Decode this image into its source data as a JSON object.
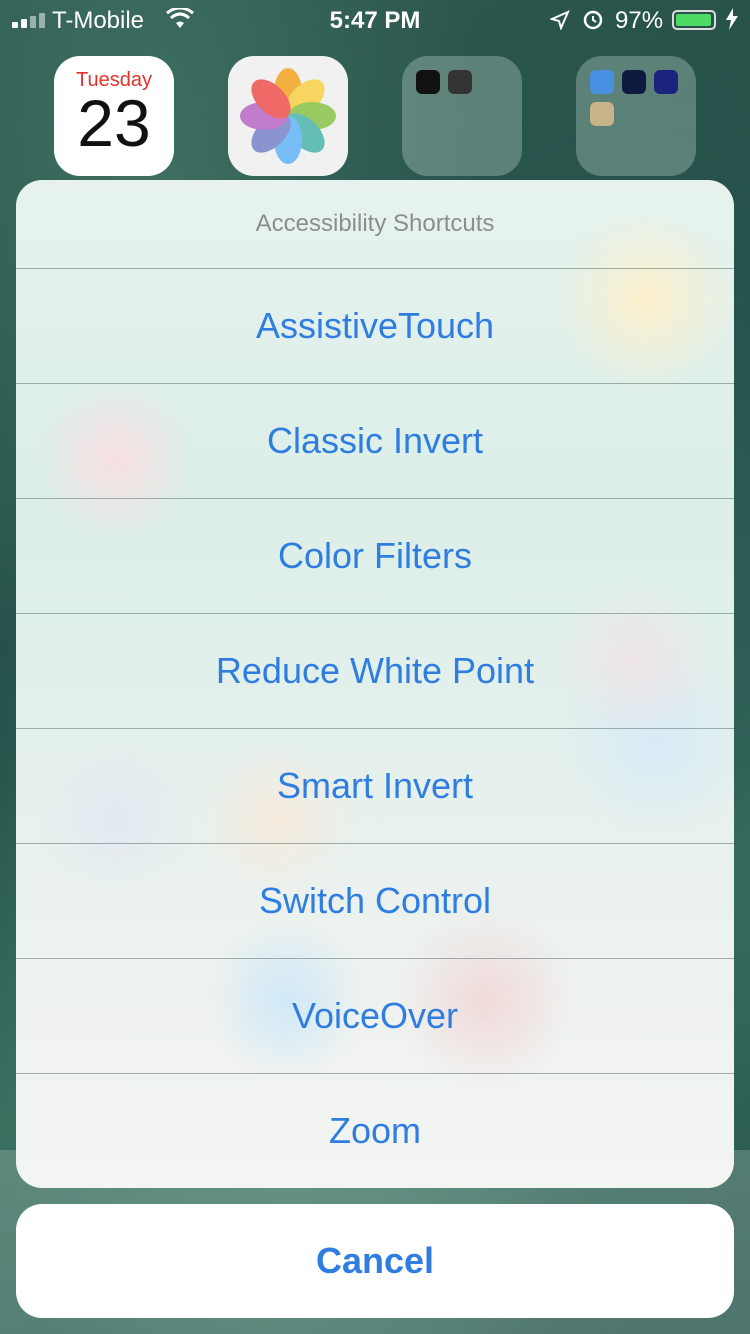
{
  "status_bar": {
    "carrier": "T-Mobile",
    "time": "5:47 PM",
    "battery_percent": "97%",
    "battery_level": 0.97,
    "icons": [
      "signal-icon",
      "wifi-icon",
      "location-icon",
      "alarm-icon",
      "battery-icon",
      "charging-icon"
    ]
  },
  "home": {
    "calendar": {
      "day": "Tuesday",
      "date": "23"
    }
  },
  "sheet": {
    "title": "Accessibility Shortcuts",
    "items": [
      "AssistiveTouch",
      "Classic Invert",
      "Color Filters",
      "Reduce White Point",
      "Smart Invert",
      "Switch Control",
      "VoiceOver",
      "Zoom"
    ],
    "cancel": "Cancel",
    "accent_color": "#2f7de1"
  }
}
